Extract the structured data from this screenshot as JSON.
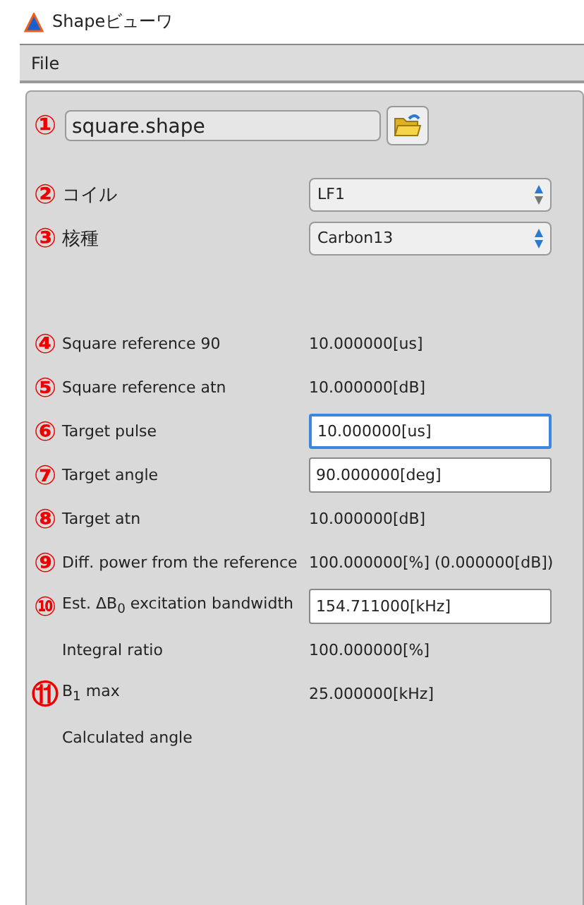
{
  "window": {
    "title": "Shapeビューワ"
  },
  "menu": [
    "File"
  ],
  "file": {
    "marker": "①",
    "value": "square.shape"
  },
  "selects": [
    {
      "marker": "②",
      "label": "コイル",
      "value": "LF1"
    },
    {
      "marker": "③",
      "label": "核種",
      "value": "Carbon13"
    }
  ],
  "rows": [
    {
      "kind": "value",
      "marker": "④",
      "label": "Square reference 90",
      "value": "10.000000[us]"
    },
    {
      "kind": "value",
      "marker": "⑤",
      "label": "Square reference atn",
      "value": "10.000000[dB]"
    },
    {
      "kind": "input",
      "marker": "⑥",
      "label": "Target pulse",
      "value": "10.000000[us]",
      "focused": true
    },
    {
      "kind": "input",
      "marker": "⑦",
      "label": "Target angle",
      "value": "90.000000[deg]",
      "focused": false
    },
    {
      "kind": "value",
      "marker": "⑧",
      "label": "Target atn",
      "value": "10.000000[dB]"
    },
    {
      "kind": "value",
      "marker": "⑨",
      "label": "Diff. power from the reference",
      "value": "100.000000[%] (0.000000[dB])"
    },
    {
      "kind": "input",
      "marker": "⑩",
      "label": "Est. ΔB$_{0}$ excitation bandwidth",
      "value": "154.711000[kHz]",
      "focused": false
    },
    {
      "kind": "value",
      "label": "Integral ratio",
      "value": "100.000000[%]"
    },
    {
      "kind": "value",
      "marker": "⑪",
      "label": "B$_{1}$ max",
      "value": "25.000000[kHz]"
    },
    {
      "kind": "value",
      "label": "Calculated angle"
    }
  ]
}
